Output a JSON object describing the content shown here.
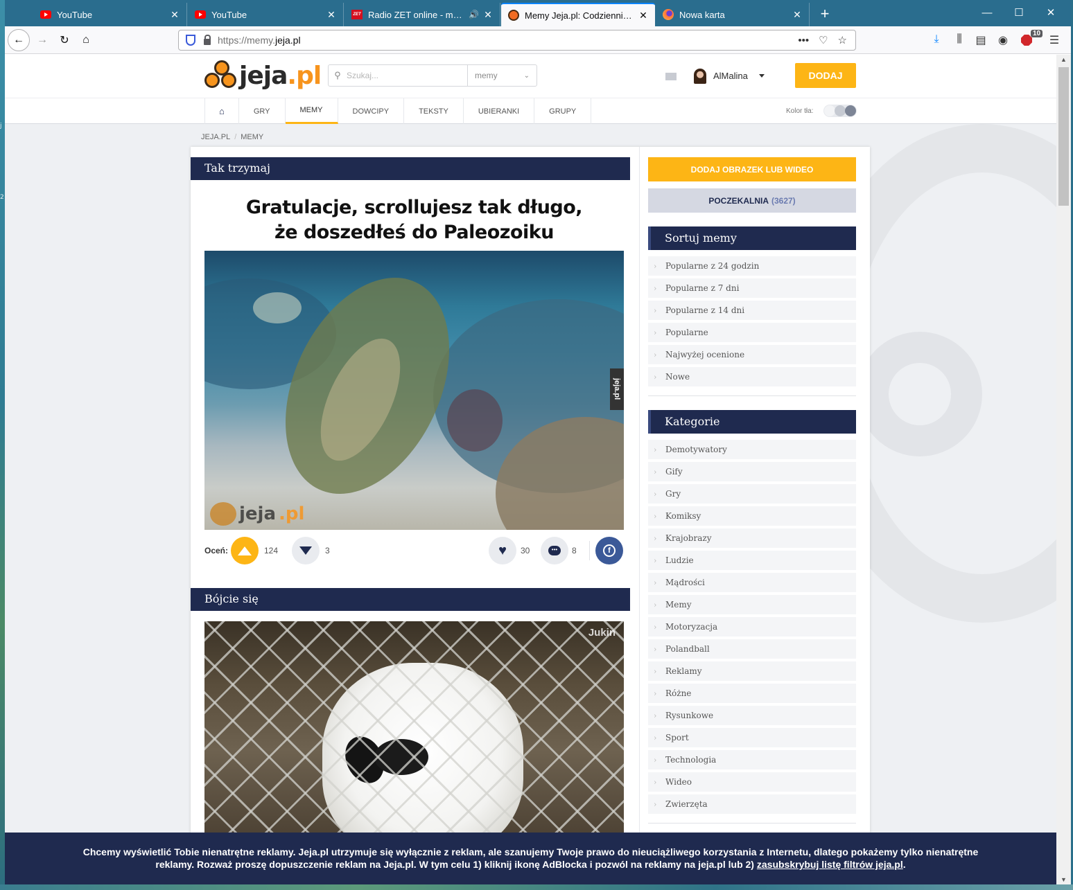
{
  "browser": {
    "tabs": [
      {
        "title": "YouTube",
        "favicon": "youtube-icon",
        "audio": false
      },
      {
        "title": "YouTube",
        "favicon": "youtube-icon",
        "audio": false
      },
      {
        "title": "Radio ZET online - muzyczna",
        "favicon": "radio-zet-icon",
        "audio": true
      },
      {
        "title": "Memy Jeja.pl: Codziennie nowe",
        "favicon": "jeja-icon",
        "audio": false,
        "active": true
      },
      {
        "title": "Nowa karta",
        "favicon": "firefox-icon",
        "audio": false
      }
    ],
    "url_prefix": "https://memy.",
    "url_domain": "jeja.pl",
    "extension_badge": "10"
  },
  "site": {
    "logo_main": "jeja",
    "logo_tld": ".pl",
    "search_placeholder": "Szukaj...",
    "search_scope": "memy",
    "username": "AlMalina",
    "add_button": "DODAJ",
    "menu": [
      "GRY",
      "MEMY",
      "DOWCIPY",
      "TEKSTY",
      "UBIERANKI",
      "GRUPY"
    ],
    "active_menu": "MEMY",
    "bg_color_label": "Kolor tła:",
    "accent_color": "#fdb515",
    "navy_color": "#1f2a4f"
  },
  "breadcrumb": [
    "JEJA.PL",
    "MEMY"
  ],
  "posts": [
    {
      "header": "Tak trzymaj",
      "title_line1": "Gratulacje, scrollujesz tak długo,",
      "title_line2": "że doszedłeś do Paleozoiku",
      "rate_label": "Oceń:",
      "upvotes": "124",
      "downvotes": "3",
      "likes": "30",
      "comments": "8",
      "image_watermark_main": "jeja",
      "image_watermark_tld": ".pl",
      "image_side_tag": "jeja.pl"
    },
    {
      "header": "Bójcie się",
      "image_watermark": "Jukin"
    }
  ],
  "sidebar": {
    "add_media_button": "DODAJ OBRAZEK LUB WIDEO",
    "waiting_room_label": "POCZEKALNIA",
    "waiting_room_count": "(3627)",
    "sort_header": "Sortuj memy",
    "sort_items": [
      "Popularne z 24 godzin",
      "Popularne z 7 dni",
      "Popularne z 14 dni",
      "Popularne",
      "Najwyżej ocenione",
      "Nowe"
    ],
    "categories_header": "Kategorie",
    "categories": [
      "Demotywatory",
      "Gify",
      "Gry",
      "Komiksy",
      "Krajobrazy",
      "Ludzie",
      "Mądrości",
      "Memy",
      "Motoryzacja",
      "Polandball",
      "Reklamy",
      "Różne",
      "Rysunkowe",
      "Sport",
      "Technologia",
      "Wideo",
      "Zwierzęta"
    ]
  },
  "cookie_banner": {
    "text": "Chcemy wyświetlić Tobie nienatrętne reklamy. Jeja.pl utrzymuje się wyłącznie z reklam, ale szanujemy Twoje prawo do nieuciążliwego korzystania z Internetu, dlatego pokażemy tylko nienatrętne reklamy. Rozważ proszę dopuszczenie reklam na Jeja.pl. W tym celu 1) kliknij ikonę AdBlocka i pozwól na reklamy na jeja.pl lub 2) ",
    "link": "zasubskrybuj listę filtrów jeja.pl",
    "suffix": "."
  },
  "desktop": {
    "edge_glyph_1": "j",
    "edge_glyph_2": "2"
  }
}
